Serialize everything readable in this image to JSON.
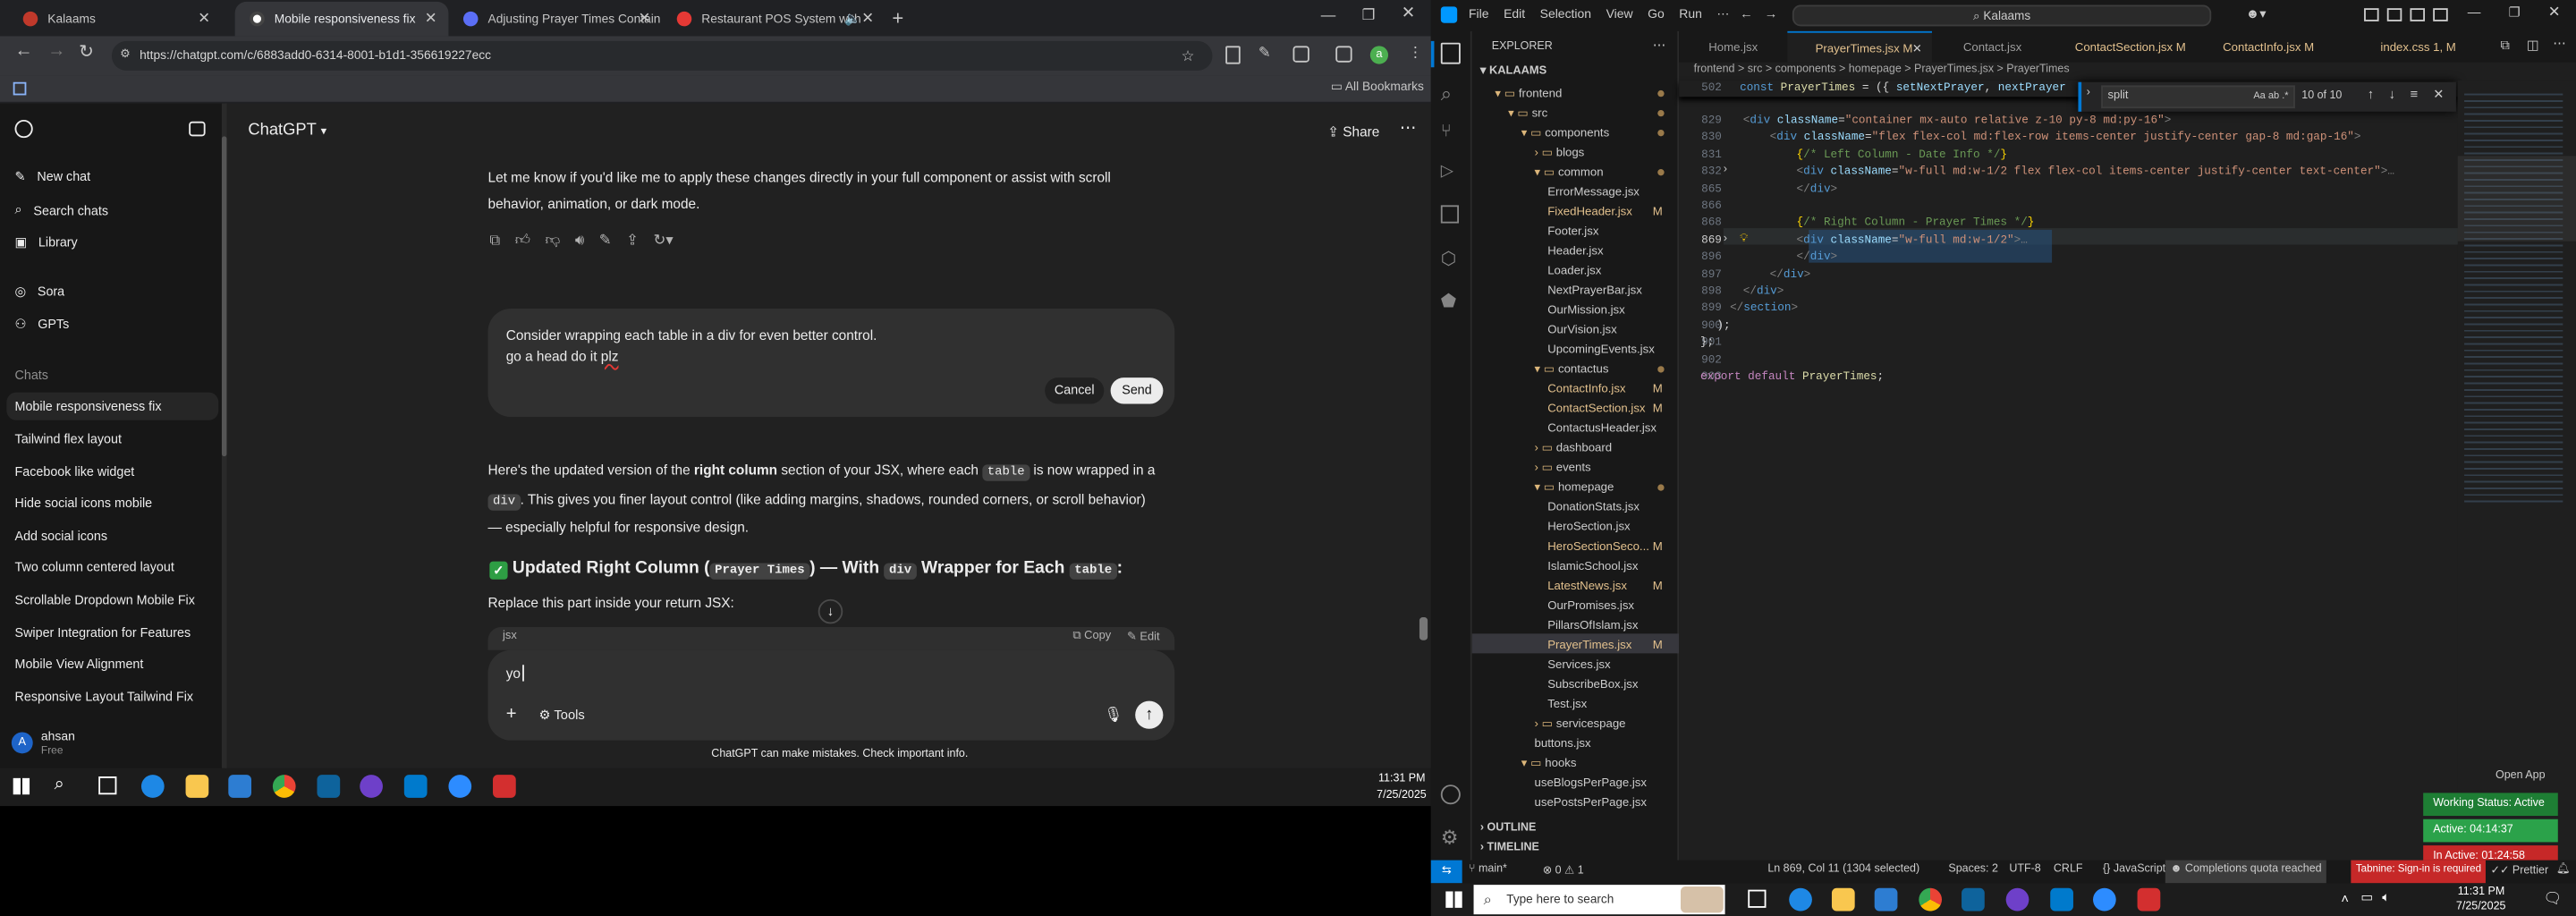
{
  "chrome": {
    "tabs": [
      {
        "title": "Kalaams"
      },
      {
        "title": "Mobile responsiveness fix"
      },
      {
        "title": "Adjusting Prayer Times Contain"
      },
      {
        "title": "Restaurant POS System with"
      }
    ],
    "url": "https://chatgpt.com/c/6883add0-6314-8001-b1d1-356619227ecc",
    "all_bookmarks": "All Bookmarks",
    "profile_initial": "a"
  },
  "chatgpt": {
    "model": "ChatGPT",
    "share": "Share",
    "sidebar": {
      "new_chat": "New chat",
      "search": "Search chats",
      "library": "Library",
      "sora": "Sora",
      "gpts": "GPTs",
      "chats_heading": "Chats",
      "chats": [
        "Mobile responsiveness fix",
        "Tailwind flex layout",
        "Facebook like widget",
        "Hide social icons mobile",
        "Add social icons",
        "Two column centered layout",
        "Scrollable Dropdown Mobile Fix",
        "Swiper Integration for Features",
        "Mobile View Alignment",
        "Responsive Layout Tailwind Fix"
      ],
      "user_initial": "A",
      "user_name": "ahsan",
      "user_plan": "Free"
    },
    "msg1_line1": "Let me know if you'd like me to apply these changes directly in your full component or assist with scroll",
    "msg1_line2": "behavior, animation, or dark mode.",
    "edit_line1": "Consider wrapping each table in a div for even better control.",
    "edit_line2a": "go a head do it ",
    "edit_line2b": "plz",
    "cancel": "Cancel",
    "send": "Send",
    "resp_p1a": "Here's the updated version of the ",
    "resp_p1b": "right column",
    "resp_p1c": " section of your JSX, where each ",
    "resp_code_table": "table",
    "resp_p1d": " is now wrapped in a",
    "resp_code_div": "div",
    "resp_p1e": ". This gives you finer layout control (like adding margins, shadows, rounded corners, or scroll behavior)",
    "resp_p1f": "— especially helpful for responsive design.",
    "heading_a": "Updated Right Column (",
    "heading_code1": "Prayer Times",
    "heading_b": ") — With ",
    "heading_code2": "div",
    "heading_c": " Wrapper for Each ",
    "heading_code3": "table",
    "heading_d": ":",
    "replace_text": "Replace this part inside your return JSX:",
    "code_lang": "jsx",
    "copy": "Copy",
    "edit": "Edit",
    "composer_text": "yo",
    "tools": "Tools",
    "disclaimer": "ChatGPT can make mistakes. Check important info."
  },
  "taskbar_left": {
    "time": "11:31 PM",
    "date": "7/25/2025"
  },
  "vscode": {
    "menu": [
      "File",
      "Edit",
      "Selection",
      "View",
      "Go",
      "Run"
    ],
    "search": "Kalaams",
    "explorer_title": "EXPLORER",
    "root": "KALAAMS",
    "tree": [
      {
        "label": "frontend",
        "depth": 1,
        "type": "folder-open",
        "dot": true
      },
      {
        "label": "src",
        "depth": 2,
        "type": "folder-open",
        "dot": true
      },
      {
        "label": "components",
        "depth": 3,
        "type": "folder-open",
        "dot": true
      },
      {
        "label": "blogs",
        "depth": 4,
        "type": "folder"
      },
      {
        "label": "common",
        "depth": 4,
        "type": "folder-open",
        "dot": true
      },
      {
        "label": "ErrorMessage.jsx",
        "depth": 5,
        "type": "file"
      },
      {
        "label": "FixedHeader.jsx",
        "depth": 5,
        "type": "file",
        "mod": "M"
      },
      {
        "label": "Footer.jsx",
        "depth": 5,
        "type": "file"
      },
      {
        "label": "Header.jsx",
        "depth": 5,
        "type": "file"
      },
      {
        "label": "Loader.jsx",
        "depth": 5,
        "type": "file"
      },
      {
        "label": "NextPrayerBar.jsx",
        "depth": 5,
        "type": "file"
      },
      {
        "label": "OurMission.jsx",
        "depth": 5,
        "type": "file"
      },
      {
        "label": "OurVision.jsx",
        "depth": 5,
        "type": "file"
      },
      {
        "label": "UpcomingEvents.jsx",
        "depth": 5,
        "type": "file"
      },
      {
        "label": "contactus",
        "depth": 4,
        "type": "folder-open",
        "dot": true
      },
      {
        "label": "ContactInfo.jsx",
        "depth": 5,
        "type": "file",
        "mod": "M"
      },
      {
        "label": "ContactSection.jsx",
        "depth": 5,
        "type": "file",
        "mod": "M"
      },
      {
        "label": "ContactusHeader.jsx",
        "depth": 5,
        "type": "file"
      },
      {
        "label": "dashboard",
        "depth": 4,
        "type": "folder"
      },
      {
        "label": "events",
        "depth": 4,
        "type": "folder"
      },
      {
        "label": "homepage",
        "depth": 4,
        "type": "folder-open",
        "dot": true
      },
      {
        "label": "DonationStats.jsx",
        "depth": 5,
        "type": "file"
      },
      {
        "label": "HeroSection.jsx",
        "depth": 5,
        "type": "file"
      },
      {
        "label": "HeroSectionSeco...",
        "depth": 5,
        "type": "file",
        "mod": "M"
      },
      {
        "label": "IslamicSchool.jsx",
        "depth": 5,
        "type": "file"
      },
      {
        "label": "LatestNews.jsx",
        "depth": 5,
        "type": "file",
        "mod": "M"
      },
      {
        "label": "OurPromises.jsx",
        "depth": 5,
        "type": "file"
      },
      {
        "label": "PillarsOfIslam.jsx",
        "depth": 5,
        "type": "file"
      },
      {
        "label": "PrayerTimes.jsx",
        "depth": 5,
        "type": "file",
        "mod": "M",
        "selected": true
      },
      {
        "label": "Services.jsx",
        "depth": 5,
        "type": "file"
      },
      {
        "label": "SubscribeBox.jsx",
        "depth": 5,
        "type": "file"
      },
      {
        "label": "Test.jsx",
        "depth": 5,
        "type": "file"
      },
      {
        "label": "servicespage",
        "depth": 4,
        "type": "folder"
      },
      {
        "label": "buttons.jsx",
        "depth": 4,
        "type": "file"
      },
      {
        "label": "hooks",
        "depth": 3,
        "type": "folder-open"
      },
      {
        "label": "useBlogsPerPage.jsx",
        "depth": 4,
        "type": "file"
      },
      {
        "label": "usePostsPerPage.jsx",
        "depth": 4,
        "type": "file"
      }
    ],
    "outline": "OUTLINE",
    "timeline": "TIMELINE",
    "tabs": [
      {
        "label": "Home.jsx"
      },
      {
        "label": "PrayerTimes.jsx  M",
        "active": true
      },
      {
        "label": "Contact.jsx"
      },
      {
        "label": "ContactSection.jsx  M"
      },
      {
        "label": "ContactInfo.jsx  M"
      },
      {
        "label": "index.css  1, M"
      }
    ],
    "breadcrumb": "frontend > src > components > homepage > PrayerTimes.jsx > PrayerTimes",
    "find_text": "split",
    "find_count": "10 of 10",
    "sticky_line": "502",
    "sticky_code": "const PrayerTimes = ({ setNextPrayer, nextPrayer",
    "lines": [
      "829",
      "830",
      "831",
      "832",
      "865",
      "866",
      "868",
      "869",
      "896",
      "897",
      "898",
      "899",
      "900",
      "901",
      "902",
      "903"
    ],
    "statusbar": {
      "branch": "main*",
      "problems": "⊗ 0 ⚠ 1",
      "position": "Ln 869, Col 11 (1304 selected)",
      "spaces": "Spaces: 2",
      "encoding": "UTF-8",
      "eol": "CRLF",
      "language": "JavaScript JSX",
      "quota": "Completions quota reached",
      "tabnine": "Tabnine: Sign-in is required",
      "prettier": "Prettier"
    },
    "open_app": "Open App",
    "working_status": "Working Status: Active",
    "active_time": "Active: 04:14:37",
    "inactive_time": "In Active: 01:24:58"
  },
  "taskbar_right": {
    "search": "Type here to search",
    "time": "11:31 PM",
    "date": "7/25/2025"
  }
}
